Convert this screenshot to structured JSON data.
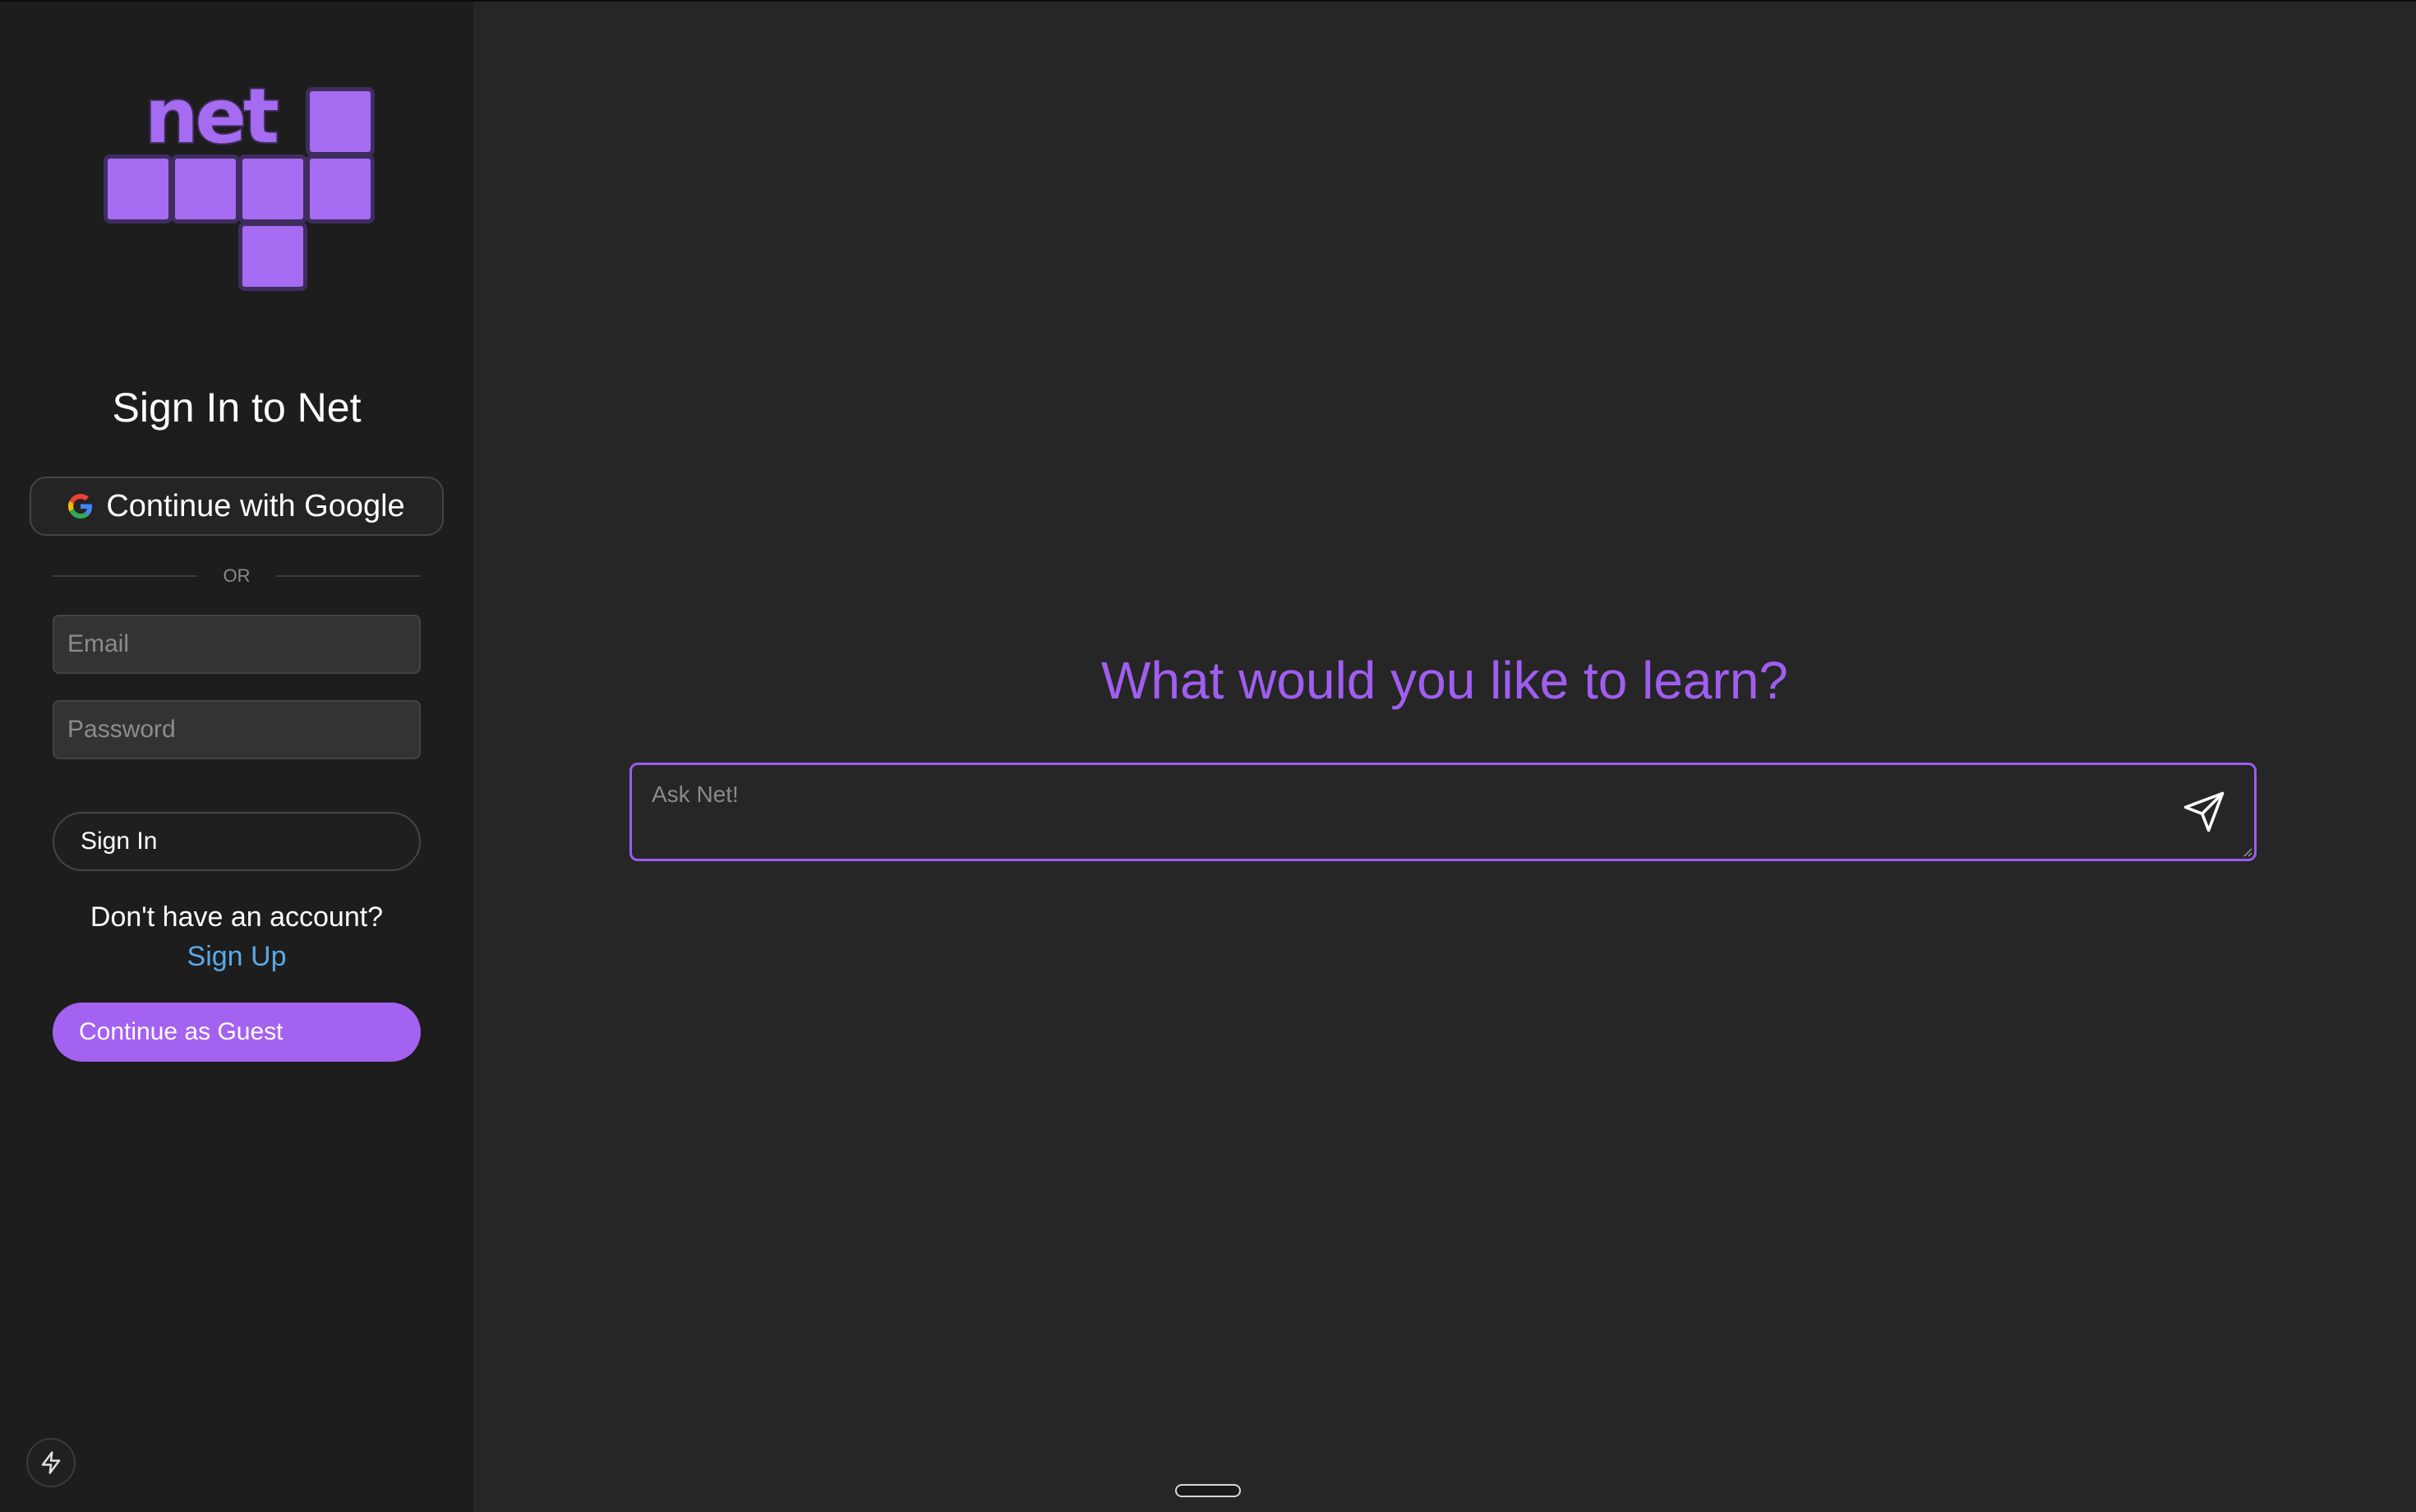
{
  "logo": {
    "text": "net",
    "brand_color": "#a56bf1"
  },
  "sidebar": {
    "title": "Sign In to Net",
    "google_button_label": "Continue with Google",
    "divider_text": "OR",
    "email_placeholder": "Email",
    "password_placeholder": "Password",
    "signin_button_label": "Sign In",
    "no_account_text": "Don't have an account?",
    "signup_link_label": "Sign Up",
    "guest_button_label": "Continue as Guest",
    "bottom_icon": "lightning-bolt-icon"
  },
  "main": {
    "heading": "What would you like to learn?",
    "ask_placeholder": "Ask Net!",
    "send_icon": "send-icon",
    "accent_color": "#a05ef0"
  }
}
